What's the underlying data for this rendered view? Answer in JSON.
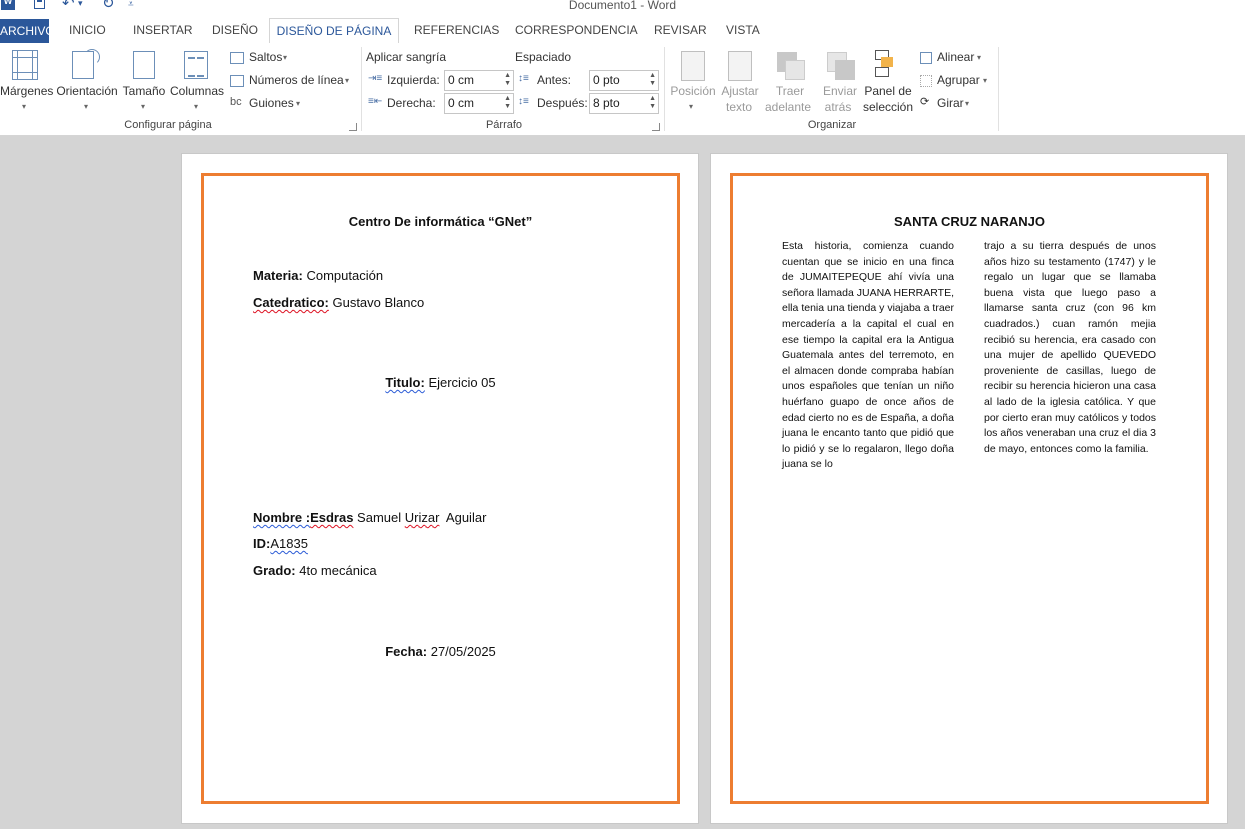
{
  "app": {
    "title": "Documento1 - Word",
    "logo_letter": "W"
  },
  "tabs": [
    "ARCHIVO",
    "INICIO",
    "INSERTAR",
    "DISEÑO",
    "DISEÑO DE PÁGINA",
    "REFERENCIAS",
    "CORRESPONDENCIA",
    "REVISAR",
    "VISTA"
  ],
  "ribbon": {
    "configurar": {
      "group_label": "Configurar página",
      "margenes": "Márgenes",
      "orientacion": "Orientación",
      "tamano": "Tamaño",
      "columnas": "Columnas",
      "saltos": "Saltos",
      "numeros_linea": "Números de línea",
      "guiones": "Guiones"
    },
    "parrafo": {
      "group_label": "Párrafo",
      "aplicar_sangria": "Aplicar sangría",
      "izquierda_label": "Izquierda:",
      "izquierda_value": "0 cm",
      "derecha_label": "Derecha:",
      "derecha_value": "0 cm",
      "espaciado": "Espaciado",
      "antes_label": "Antes:",
      "antes_value": "0 pto",
      "despues_label": "Después:",
      "despues_value": "8 pto"
    },
    "organizar": {
      "group_label": "Organizar",
      "posicion": "Posición",
      "ajustar_1": "Ajustar",
      "ajustar_2": "texto",
      "traer_1": "Traer",
      "traer_2": "adelante",
      "enviar_1": "Enviar",
      "enviar_2": "atrás",
      "panel_1": "Panel de",
      "panel_2": "selección",
      "alinear": "Alinear",
      "agrupar": "Agrupar",
      "girar": "Girar"
    }
  },
  "page1": {
    "heading": "Centro De informática “GNet”",
    "materia_label": "Materia:",
    "materia_value": " Computación",
    "catedratico_label": "Catedratico:",
    "catedratico_value": " Gustavo Blanco",
    "titulo_label": "Titulo:",
    "titulo_value": " Ejercicio 05",
    "nombre_label_a": "Nombre :",
    "nombre_label_b": "Esdras",
    "nombre_value_a": " Samuel ",
    "nombre_value_b": "Urizar",
    "nombre_value_c": "  Aguilar",
    "id_label": "ID:",
    "id_value": "A1835",
    "grado_label": "Grado:",
    "grado_value": " 4to mecánica",
    "fecha_label": "Fecha:",
    "fecha_value": " 27/05/2025"
  },
  "page2": {
    "heading": "SANTA CRUZ NARANJO",
    "col1": "Esta historia, comienza cuando cuentan que se inicio en una finca de JUMAITEPEQUE ahí vivía una señora llamada JUANA HERRARTE, ella tenia una tienda y viajaba a traer mercadería a la capital el cual en ese tiempo la capital era la Antigua Guatemala antes del terremoto, en el almacen donde compraba habían unos españoles que tenían un niño huérfano guapo de once años de edad cierto no es de España, a doña juana le encanto tanto que pidió que lo pidió y se lo regalaron, llego doña juana se lo",
    "col2": "trajo a su tierra después de unos años hizo su testamento (1747) y le regalo un lugar que se llamaba buena vista que luego paso a llamarse santa cruz (con 96 km cuadrados.) cuan ramón mejia recibió su herencia, era casado con una mujer de apellido QUEVEDO proveniente de casillas, luego de recibir su herencia hicieron una casa al lado de la iglesia católica. Y que por cierto eran muy católicos y todos los años veneraban una cruz el dia 3 de mayo, entonces como la familia."
  }
}
